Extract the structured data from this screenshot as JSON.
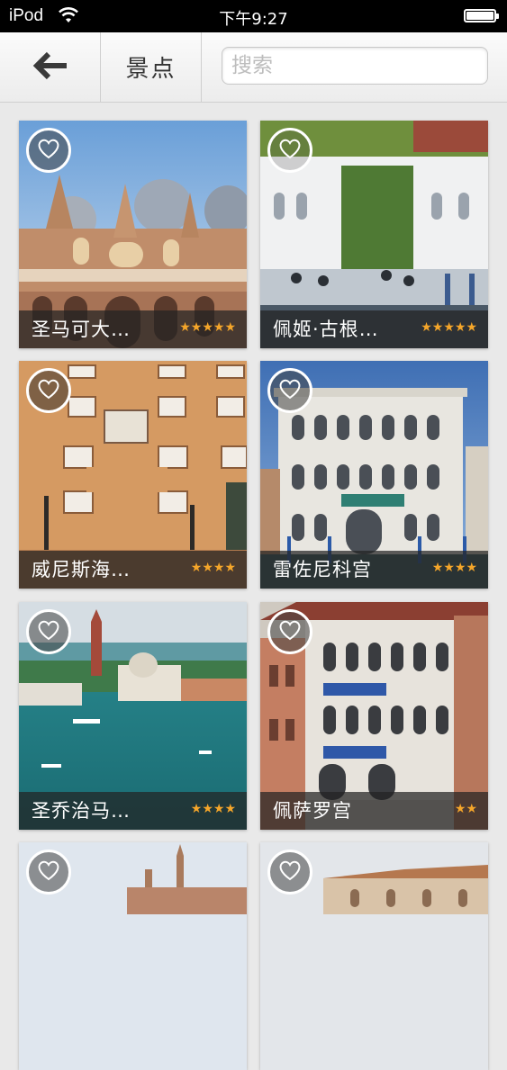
{
  "status_bar": {
    "carrier": "iPod",
    "time": "下午9:27"
  },
  "nav": {
    "back_icon": "arrow-left-icon",
    "title": "景点",
    "search_placeholder": "搜索",
    "search_value": ""
  },
  "attractions": [
    {
      "name": "圣马可大…",
      "rating": 5,
      "stars": "★★★★★"
    },
    {
      "name": "佩姬·古根…",
      "rating": 5,
      "stars": "★★★★★"
    },
    {
      "name": "威尼斯海…",
      "rating": 4,
      "stars": "★★★★"
    },
    {
      "name": "雷佐尼科宫",
      "rating": 4,
      "stars": "★★★★"
    },
    {
      "name": "圣乔治马…",
      "rating": 4,
      "stars": "★★★★"
    },
    {
      "name": "佩萨罗宫",
      "rating": 2,
      "stars": "★★"
    },
    {
      "name": "",
      "rating": null,
      "stars": ""
    },
    {
      "name": "",
      "rating": null,
      "stars": ""
    }
  ],
  "colors": {
    "star": "#f5a62a",
    "background": "#e9e9e9",
    "caption": "#232323"
  },
  "favorite_icon": "heart-outline-icon"
}
